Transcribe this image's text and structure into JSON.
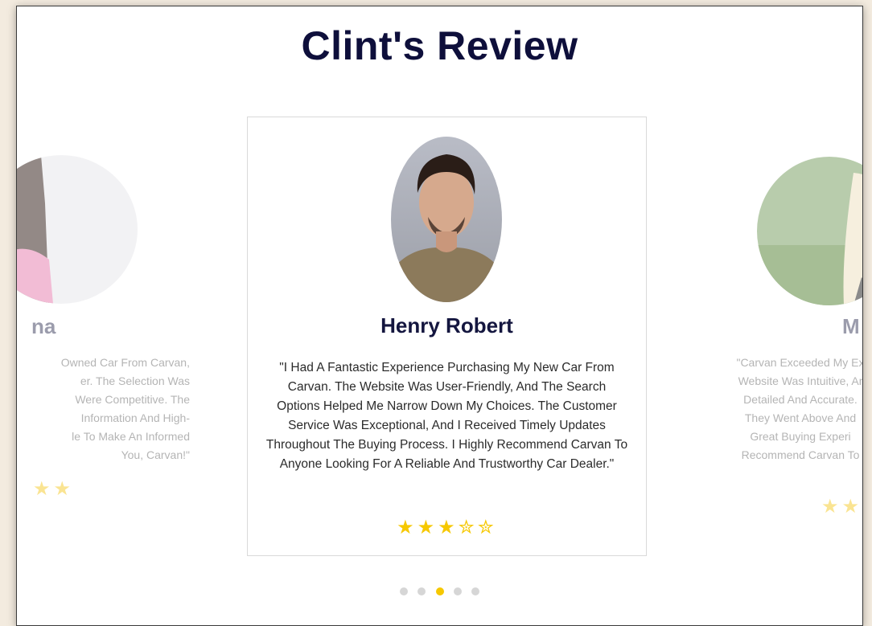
{
  "section": {
    "title_main": "Clint's",
    "title_highlight": "Review"
  },
  "reviews": {
    "left": {
      "name_partial": "na",
      "quote_lines": [
        "Owned Car From Carvan,",
        "er. The Selection Was",
        "Were Competitive. The",
        "Information And High-",
        "le To Make An Informed",
        "You, Carvan!\""
      ],
      "stars": "★★"
    },
    "center": {
      "name": "Henry Robert",
      "quote": "\"I Had A Fantastic Experience Purchasing My New Car From Carvan. The Website Was User-Friendly, And The Search Options Helped Me Narrow Down My Choices. The Customer Service Was Exceptional, And I Received Timely Updates Throughout The Buying Process. I Highly Recommend Carvan To Anyone Looking For A Reliable And Trustworthy Car Dealer.\"",
      "stars": "★★★✮✮"
    },
    "right": {
      "name_partial": "M",
      "quote_lines": [
        "\"Carvan Exceeded My Ex",
        "Website Was Intuitive, Ar",
        "Detailed And Accurate.",
        "They Went Above And",
        "Great Buying Experi",
        "Recommend Carvan To"
      ],
      "stars": "★★"
    }
  },
  "pagination": {
    "count": 5,
    "active_index": 2
  },
  "colors": {
    "accent": "#f9d30f",
    "title": "#0e0f3b",
    "star": "#f6c800"
  }
}
